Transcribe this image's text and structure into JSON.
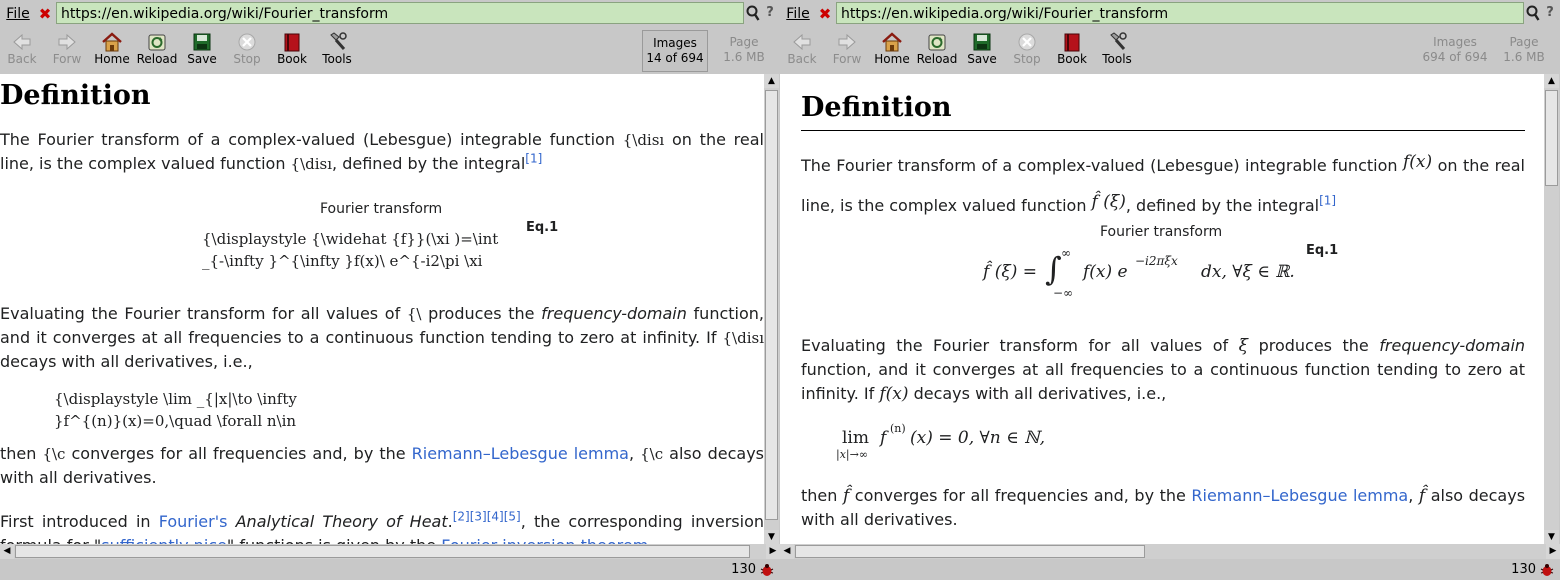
{
  "url": "https://en.wikipedia.org/wiki/Fourier_transform",
  "menu_file": "File",
  "toolbar": {
    "back": "Back",
    "forward": "Forw",
    "home": "Home",
    "reload": "Reload",
    "save": "Save",
    "stop": "Stop",
    "book": "Book",
    "tools": "Tools",
    "images_label": "Images",
    "page_label": "Page",
    "page_size": "1.6 MB"
  },
  "left": {
    "images_count": "14 of 694",
    "status_number": "130",
    "heading": "Definition",
    "p1_a": "The Fourier transform of a complex-valued (Lebesgue) integrable function",
    "p1_m1": "{\\disı",
    "p1_b": "on the real line, is the complex valued function",
    "p1_m2": "{\\disı",
    "p1_c": ", defined by the integral",
    "ref1": "[1]",
    "caption": "Fourier transform",
    "eq_label": "Eq.1",
    "eq_raw_1": "{\\displaystyle {\\widehat {f}}(\\xi )=\\int",
    "eq_raw_2": "_{-\\infty }^{\\infty }f(x)\\ e^{-i2\\pi \\xi",
    "p2_a": "Evaluating the Fourier transform for all values of",
    "p2_m1": "{\\",
    "p2_b": "produces the",
    "p2_italic": "frequency-domain",
    "p2_c": "function, and it converges at all frequencies to a continuous function tending to zero at infinity. If",
    "p2_m2": "{\\disı",
    "p2_d": "decays with all derivatives, i.e.,",
    "lim_raw_1": "{\\displaystyle \\lim _{|x|\\to \\infty",
    "lim_raw_2": "}f^{(n)}(x)=0,\\quad \\forall n\\in",
    "p3_a": "then",
    "p3_m1": "{\\c",
    "p3_b": "converges for all frequencies and, by the",
    "p3_link": "Riemann–Lebesgue lemma",
    "p3_c": ",",
    "p3_m2": "{\\c",
    "p3_d": "also decays with all derivatives.",
    "p4_a": "First introduced in",
    "p4_link1": "Fourier's",
    "p4_italic": "Analytical Theory of Heat",
    "p4_refs": "[2][3][4][5]",
    "p4_b": ", the corresponding",
    "p4_c": "inversion formula for \"",
    "p4_link2": "sufficiently nice",
    "p4_d": "\" functions is given by the",
    "p4_link3": "Fourier inversion theorem"
  },
  "right": {
    "images_count": "694 of 694",
    "status_number": "130",
    "heading": "Definition",
    "p1_a": "The Fourier transform of a complex-valued (Lebesgue) integrable function",
    "p1_b": "on the real line, is the complex valued function",
    "p1_c": ", defined by the integral",
    "ref1": "[1]",
    "caption": "Fourier transform",
    "eq_label": "Eq.1",
    "p2_a": "Evaluating the Fourier transform for all values of",
    "p2_b": "produces the",
    "p2_italic": "frequency-domain",
    "p2_c": "function, and it converges at all frequencies to a continuous function tending to zero at infinity. If",
    "p2_d": "decays with all derivatives, i.e.,",
    "p3_a": "then",
    "p3_b": "converges for all frequencies and, by the",
    "p3_link": "Riemann–Lebesgue lemma",
    "p3_c": ",",
    "p3_d": "also decays with all derivatives."
  },
  "math": {
    "f_of_x": "f(x)",
    "fhat_of_xi": "f̂ (ξ)",
    "xi": "ξ",
    "fhat": "f̂",
    "eq_lhs": "f̂ (ξ) =",
    "eq_int_sup": "∞",
    "eq_int_sub": "−∞",
    "eq_body": "f(x) e",
    "eq_exp": "−i2πξx",
    "eq_tail": "dx,     ∀ξ ∈ ℝ.",
    "lim_word": "lim",
    "lim_sub": "|x|→∞",
    "lim_body": "f",
    "lim_sup": "(n)",
    "lim_tail": "(x) = 0,     ∀n ∈ ℕ,"
  },
  "colors": {
    "link": "#3366cc",
    "url_bg": "#c9e5bd",
    "chrome": "#c8c8c8"
  }
}
